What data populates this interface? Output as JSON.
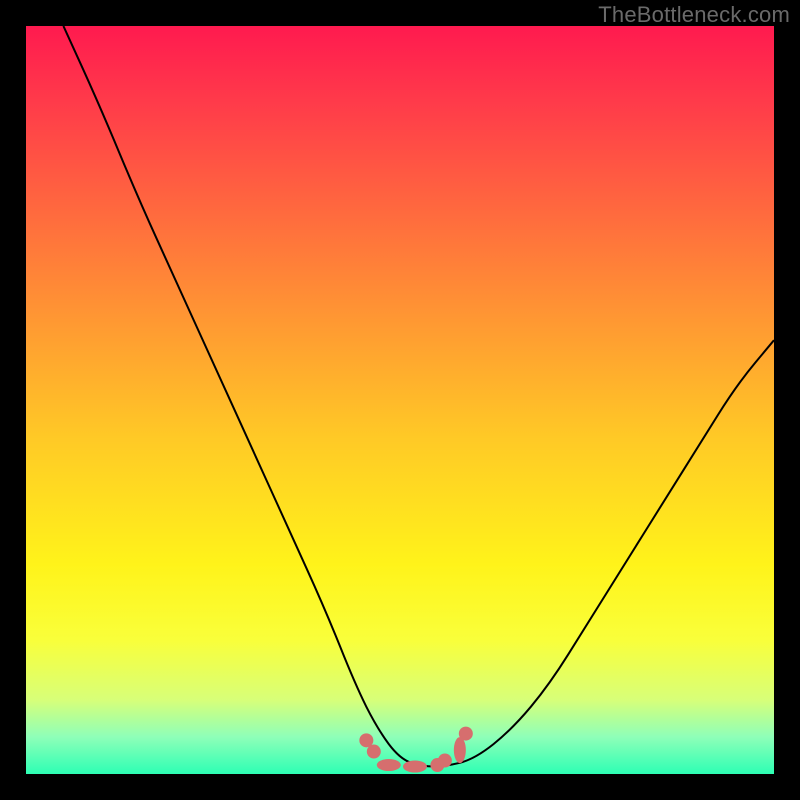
{
  "watermark": "TheBottleneck.com",
  "chart_data": {
    "type": "line",
    "title": "",
    "xlabel": "",
    "ylabel": "",
    "xlim": [
      0,
      100
    ],
    "ylim": [
      0,
      100
    ],
    "series": [
      {
        "name": "curve",
        "x": [
          5,
          10,
          15,
          20,
          25,
          30,
          35,
          40,
          44,
          47,
          50,
          53,
          56,
          60,
          65,
          70,
          75,
          80,
          85,
          90,
          95,
          100
        ],
        "values": [
          100,
          89,
          77,
          66,
          55,
          44,
          33,
          22,
          12,
          6,
          2,
          1,
          1,
          2,
          6,
          12,
          20,
          28,
          36,
          44,
          52,
          58
        ]
      }
    ],
    "markers": [
      {
        "x": 45.5,
        "y": 4.5,
        "shape": "dot"
      },
      {
        "x": 46.5,
        "y": 3.0,
        "shape": "dot"
      },
      {
        "x": 48.5,
        "y": 1.2,
        "shape": "oval"
      },
      {
        "x": 52.0,
        "y": 1.0,
        "shape": "oval"
      },
      {
        "x": 55.0,
        "y": 1.2,
        "shape": "dot"
      },
      {
        "x": 56.0,
        "y": 1.8,
        "shape": "dot"
      },
      {
        "x": 58.0,
        "y": 3.2,
        "shape": "oval-tall"
      },
      {
        "x": 58.8,
        "y": 5.4,
        "shape": "dot"
      }
    ],
    "background_gradient": [
      "#ff1a4f",
      "#ffc926",
      "#fff31a",
      "#2dffb4"
    ],
    "colors": {
      "curve": "#000000",
      "markers": "#d66e6e",
      "frame": "#000000"
    }
  }
}
